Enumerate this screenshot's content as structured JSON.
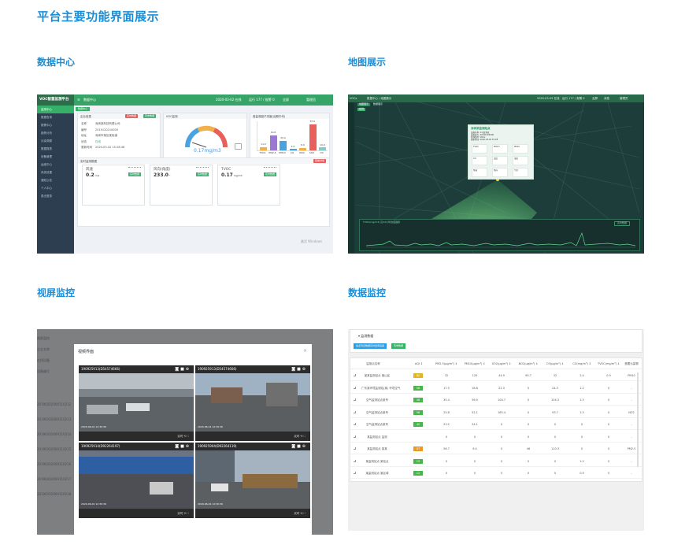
{
  "page": {
    "title": "平台主要功能界面展示",
    "sections": {
      "data_center": "数据中心",
      "map": "地图展示",
      "video": "视屏监控",
      "monitor": "数据监控"
    }
  },
  "data_center": {
    "brand": "VOC智慧监测平台",
    "nav": [
      "监测中心",
      "数据查询",
      "报警中心",
      "趋势分析",
      "污染溯源",
      "数据报表",
      "设备管理",
      "运维中心",
      "系统设置",
      "通知公告",
      "个人中心",
      "退出登录"
    ],
    "topbar": {
      "breadcrumb": "数据中心",
      "status1": "2020-03-02 在线",
      "status2": "运行 177 / 报警 0",
      "fullscreen": "全屏",
      "user": "管理员"
    },
    "tab": "数据中心",
    "info_card": {
      "title": "企业信息",
      "buttons": [
        "实时数据",
        "历史数据"
      ],
      "fields": [
        {
          "k": "名称",
          "v": "深圳某科技有限公司"
        },
        {
          "k": "编号",
          "v": "2019120210000"
        },
        {
          "k": "地址",
          "v": "深圳市某区某街道"
        },
        {
          "k": "状态",
          "v": "在线"
        },
        {
          "k": "更新时间",
          "v": "2020-03-02 15:28:46"
        }
      ]
    },
    "gauge_card": {
      "title": "VOC监测",
      "value": "0.17mg/m3"
    },
    "bar_card": {
      "title": "各监测因子浓度(近期平均)",
      "labels": [
        "TVOC",
        "PM2.5",
        "PM10",
        "CO",
        "NO2",
        "SO2",
        "O3"
      ],
      "values": [
        "11.0",
        "49.8",
        "32.0",
        "4.0",
        "8.0",
        "87.0",
        "10.0"
      ]
    },
    "factor_card": {
      "title": "实时监测数据",
      "button": "查看详情"
    },
    "tiles": [
      {
        "name": "风速",
        "value": "0.2",
        "unit": "m/s",
        "tag": "实时数据"
      },
      {
        "name": "风向(角度)",
        "value": "233.0",
        "unit": "°",
        "tag": "实时数据"
      },
      {
        "name": "TVOC",
        "value": "0.17",
        "unit": "mg/m3",
        "tag": "实时数据"
      }
    ],
    "watermark": "激活 Windows"
  },
  "map": {
    "topbar": {
      "brand": "VOCs",
      "nav": "数据中心 / 地图展示",
      "t1": "2020-03-02 在线",
      "t2": "运行 177 / 报警 0",
      "full": "全屏",
      "msg": "消息",
      "user": "管理员"
    },
    "tabs": [
      "地图展示",
      "数据展示"
    ],
    "badge": "在线",
    "popup": {
      "title": "深圳某监测站点",
      "lines": [
        "设备名称: 1号监测站",
        "设备编号: 20191202000",
        "监测类型: VOCs",
        "更新时间: 2020-03-02 15:28"
      ],
      "cells": [
        "TVOC",
        "PM2.5",
        "PM10",
        "CO",
        "温度",
        "湿度",
        "风速",
        "风向",
        "气压"
      ]
    },
    "trend": {
      "label": "TVOC(mg/m3) 近24小时浓度趋势",
      "right": "实时数据"
    }
  },
  "video": {
    "bg_labels": [
      "视屏监控",
      "企业名称",
      "在线设备",
      "设备编号"
    ],
    "bg_rows": [
      "20190202000110212",
      "20190202000110213",
      "20190202000110214",
      "20190202000110215",
      "20190202000110216",
      "20190202000110217",
      "20190202000110218"
    ],
    "modal_title": "视频界面",
    "close": "×",
    "cams": [
      {
        "id": "190925913(D54574666)",
        "ts": "2020-06-01 12:30:36",
        "footer": "实时  ⟲  ⛶"
      },
      {
        "id": "190925913(D54574666)",
        "ts": "2020-06-01 12:30:36",
        "footer": "实时  ⟲  ⛶"
      },
      {
        "id": "190925914(D92264197)",
        "ts": "2020-06-01 12:30:36",
        "footer": "实时  ⟲  ⛶"
      },
      {
        "id": "190925904(D92264119)",
        "ts": "2020-06-01 12:30:36",
        "footer": "实时  ⟲  ⛶"
      }
    ]
  },
  "monitor": {
    "crumb": "▾ 监测数据",
    "buttons": [
      "站点列表数据实时监测设备",
      "历史数据"
    ],
    "headers": [
      "监测点名称",
      "AQI ↕",
      "PM2.5(μg/m³) ↕",
      "PM10(μg/m³) ↕",
      "SO2(μg/m³) ↕",
      "NO2(μg/m³) ↕",
      "O3(μg/m³) ↕",
      "CO(mg/m³) ↕",
      "TVOC(mg/m³) ↕",
      "首要污染物"
    ],
    "rows": [
      {
        "name": "某某监测站点 南山区",
        "aqi": "82",
        "c": "#e0b622",
        "v": [
          "32",
          "120",
          "44.9",
          "95.7",
          "32",
          "2.4",
          "0.9",
          "PM10"
        ]
      },
      {
        "name": "广东某环境监测站(某) 环境空气",
        "aqi": "58",
        "c": "#49b54d",
        "v": [
          "17.5",
          "18.8",
          "22.3",
          "0",
          "24.3",
          "1.2",
          "0",
          "-"
        ]
      },
      {
        "name": "空气监测站点某号",
        "aqi": "48",
        "c": "#49b54d",
        "v": [
          "30.4",
          "36.9",
          "100.7",
          "0",
          "104.3",
          "1.5",
          "0",
          "-"
        ]
      },
      {
        "name": "空气监测站点某号",
        "aqi": "56",
        "c": "#49b54d",
        "v": [
          "25.8",
          "52.1",
          "165.4",
          "0",
          "93.7",
          "1.5",
          "0",
          "NO2"
        ]
      },
      {
        "name": "空气监测站点某号",
        "aqi": "40",
        "c": "#49b54d",
        "v": [
          "23.2",
          "34.1",
          "0",
          "0",
          "0",
          "0",
          "0",
          "-"
        ]
      },
      {
        "name": "某监测站点 监测",
        "aqi": "",
        "c": "",
        "v": [
          "0",
          "0",
          "0",
          "0",
          "0",
          "0",
          "0",
          "-"
        ]
      },
      {
        "name": "某监测站点 某某",
        "aqi": "87",
        "c": "#e89a24",
        "v": [
          "56.7",
          "9.4",
          "0",
          "46",
          "110.3",
          "0",
          "0",
          "PM2.5"
        ]
      },
      {
        "name": "某监测站点 某站点",
        "aqi": "15",
        "c": "#49b54d",
        "v": [
          "0",
          "0",
          "0",
          "0",
          "0",
          "1.2",
          "0",
          "-"
        ]
      },
      {
        "name": "某监测站点 某区域",
        "aqi": "12",
        "c": "#49b54d",
        "v": [
          "0",
          "0",
          "0",
          "0",
          "0",
          "0.9",
          "0",
          "-"
        ]
      }
    ]
  }
}
